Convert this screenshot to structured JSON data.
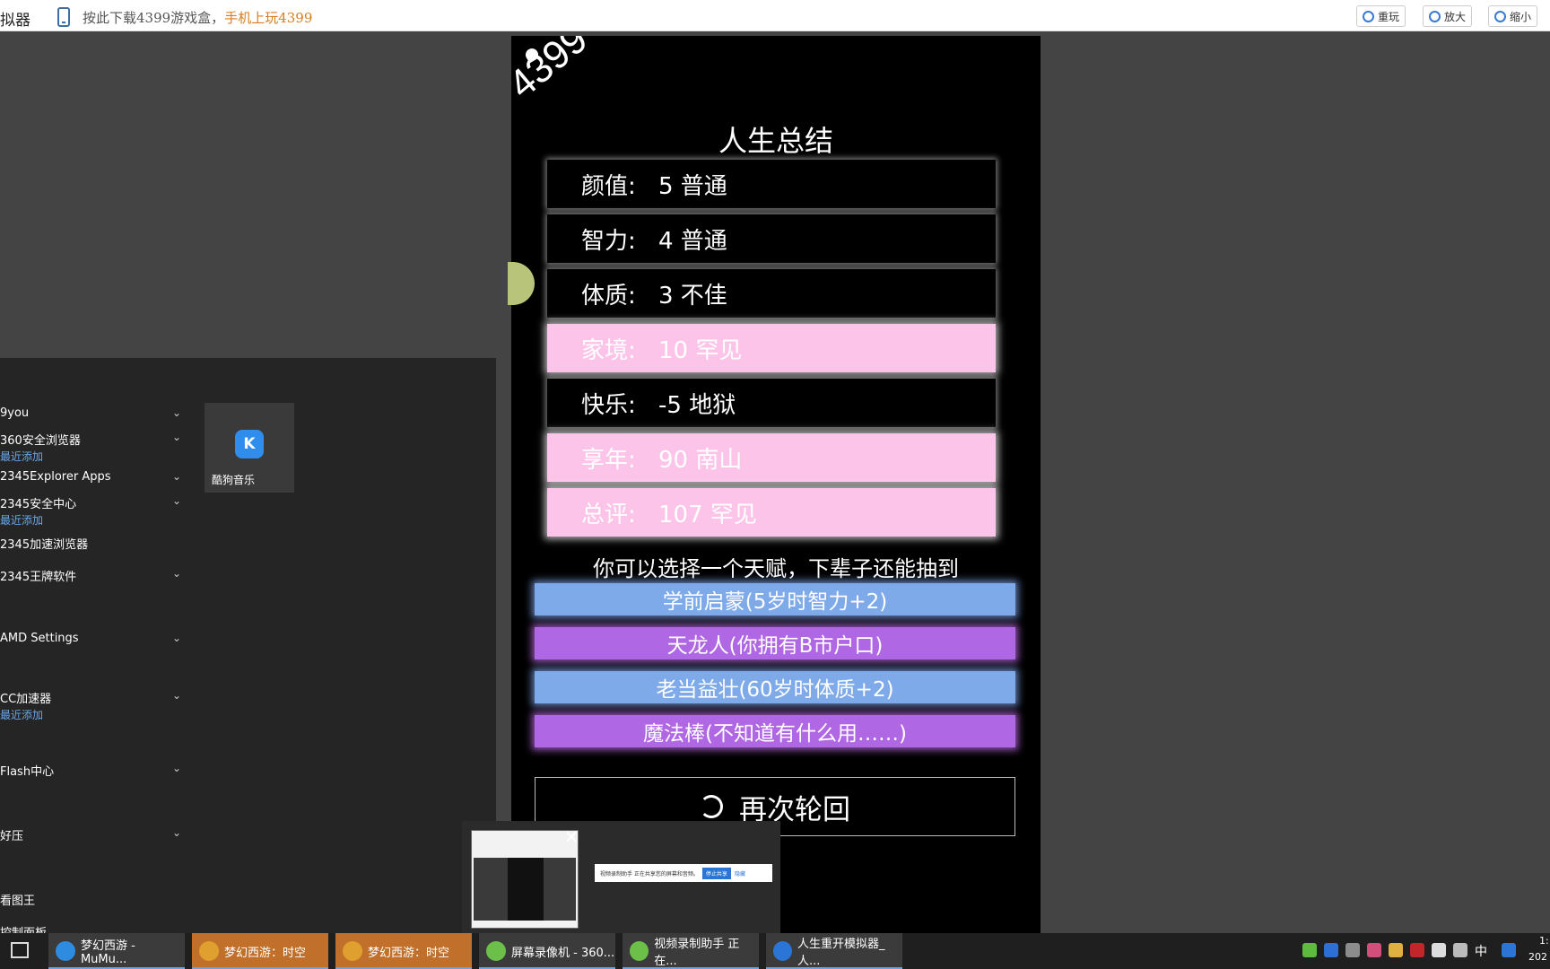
{
  "topbar": {
    "app_title": "拟器",
    "promo_part1": "按此下载4399游戏盒，",
    "promo_part2": "手机上玩4399",
    "reload_label": "重玩",
    "zoom_in_label": "放大",
    "zoom_out_label": "缩小"
  },
  "game": {
    "logo": "4399",
    "title": "人生总结",
    "stats": [
      {
        "label": "颜值:",
        "value": "5 普通",
        "style": "normal"
      },
      {
        "label": "智力:",
        "value": "4 普通",
        "style": "normal"
      },
      {
        "label": "体质:",
        "value": "3 不佳",
        "style": "normal"
      },
      {
        "label": "家境:",
        "value": "10 罕见",
        "style": "rare"
      },
      {
        "label": "快乐:",
        "value": "-5 地狱",
        "style": "normal"
      },
      {
        "label": "享年:",
        "value": "90 南山",
        "style": "rare"
      },
      {
        "label": "总评:",
        "value": "107 罕见",
        "style": "rare"
      }
    ],
    "talent_prompt": "你可以选择一个天赋，下辈子还能抽到",
    "talents": [
      {
        "label": "学前启蒙(5岁时智力+2)",
        "color": "#7faae9"
      },
      {
        "label": "天龙人(你拥有B市户口)",
        "color": "#b067e3"
      },
      {
        "label": "老当益壮(60岁时体质+2)",
        "color": "#7faae9"
      },
      {
        "label": "魔法棒(不知道有什么用……)",
        "color": "#b067e3"
      }
    ],
    "retry_label": "再次轮回"
  },
  "start_menu": {
    "items": [
      {
        "label": "9you",
        "sub": ""
      },
      {
        "label": "360安全浏览器",
        "sub": "最近添加"
      },
      {
        "label": "2345Explorer Apps",
        "sub": ""
      },
      {
        "label": "2345安全中心",
        "sub": "最近添加"
      },
      {
        "label": "2345加速浏览器",
        "sub": ""
      },
      {
        "label": "2345王牌软件",
        "sub": ""
      },
      {
        "label": "AMD Settings",
        "sub": ""
      },
      {
        "label": "CC加速器",
        "sub": "最近添加"
      },
      {
        "label": "Flash中心",
        "sub": ""
      },
      {
        "label": "好压",
        "sub": ""
      },
      {
        "label": "看图王",
        "sub": ""
      },
      {
        "label": "控制面板",
        "sub": ""
      }
    ],
    "tile_label": "酷狗音乐",
    "tile_icon_letter": "K"
  },
  "preview": {
    "share_text": "视频录制助手 正在共享您的屏幕和音频。",
    "stop_label": "停止共享",
    "hide_label": "隐藏"
  },
  "taskbar": {
    "tasks": [
      "梦幻西游 - MuMu...",
      "梦幻西游：时空",
      "梦幻西游：时空",
      "屏幕录像机 - 360...",
      "视频录制助手 正在...",
      "人生重开模拟器_人..."
    ],
    "ime": "中",
    "time": "1:",
    "date": "202"
  }
}
